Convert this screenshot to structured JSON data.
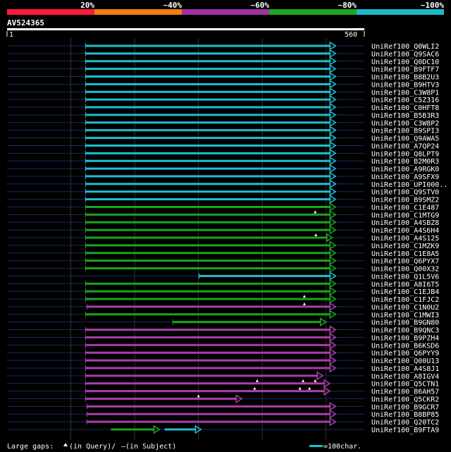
{
  "legend": {
    "bins": [
      {
        "label": "",
        "color": "#ff1a3c"
      },
      {
        "label": "20%",
        "color": "#f07e10"
      },
      {
        "label": "~40%",
        "color": "#a12fa0"
      },
      {
        "label": "~60%",
        "color": "#1fa51f"
      },
      {
        "label": "~80%",
        "color": "#1fb8c8"
      },
      {
        "label": "~100%",
        "color": null
      }
    ]
  },
  "query": {
    "name": "AV524365",
    "start": "1",
    "end": "560",
    "length": 560
  },
  "colors": {
    "cyan": "#1fbfcf",
    "green": "#1ca51c",
    "purple": "#a93ea8",
    "query_line": "#1a2a66",
    "gridline": "#333333"
  },
  "hits": [
    {
      "name": "UniRef100_Q0WLI2",
      "color": "cyan",
      "start": 123,
      "end": 515,
      "gaps": []
    },
    {
      "name": "UniRef100_Q9SAC6",
      "color": "cyan",
      "start": 123,
      "end": 515,
      "gaps": []
    },
    {
      "name": "UniRef100_Q0DC10",
      "color": "cyan",
      "start": 123,
      "end": 515,
      "gaps": []
    },
    {
      "name": "UniRef100_B9FTF7",
      "color": "cyan",
      "start": 123,
      "end": 515,
      "gaps": []
    },
    {
      "name": "UniRef100_B8B2U3",
      "color": "cyan",
      "start": 123,
      "end": 515,
      "gaps": []
    },
    {
      "name": "UniRef100_B9HTV3",
      "color": "cyan",
      "start": 123,
      "end": 515,
      "gaps": []
    },
    {
      "name": "UniRef100_C3W8P1",
      "color": "cyan",
      "start": 123,
      "end": 515,
      "gaps": []
    },
    {
      "name": "UniRef100_C5Z316",
      "color": "cyan",
      "start": 123,
      "end": 515,
      "gaps": []
    },
    {
      "name": "UniRef100_C0HFT8",
      "color": "cyan",
      "start": 123,
      "end": 515,
      "gaps": []
    },
    {
      "name": "UniRef100_B5B3R3",
      "color": "cyan",
      "start": 123,
      "end": 515,
      "gaps": []
    },
    {
      "name": "UniRef100_C3W8P2",
      "color": "cyan",
      "start": 123,
      "end": 515,
      "gaps": []
    },
    {
      "name": "UniRef100_B9SPI3",
      "color": "cyan",
      "start": 123,
      "end": 515,
      "gaps": []
    },
    {
      "name": "UniRef100_Q9AWA5",
      "color": "cyan",
      "start": 123,
      "end": 515,
      "gaps": []
    },
    {
      "name": "UniRef100_A7QP24",
      "color": "cyan",
      "start": 123,
      "end": 515,
      "gaps": []
    },
    {
      "name": "UniRef100_Q8LPT9",
      "color": "cyan",
      "start": 123,
      "end": 515,
      "gaps": []
    },
    {
      "name": "UniRef100_B2M0R3",
      "color": "cyan",
      "start": 123,
      "end": 515,
      "gaps": []
    },
    {
      "name": "UniRef100_A9RGK0",
      "color": "cyan",
      "start": 123,
      "end": 515,
      "gaps": []
    },
    {
      "name": "UniRef100_A9SFX9",
      "color": "cyan",
      "start": 123,
      "end": 515,
      "gaps": []
    },
    {
      "name": "UniRef100_UPI000..",
      "color": "cyan",
      "start": 123,
      "end": 515,
      "gaps": []
    },
    {
      "name": "UniRef100_Q9STV0",
      "color": "cyan",
      "start": 123,
      "end": 515,
      "gaps": []
    },
    {
      "name": "UniRef100_B9SMZ2",
      "color": "cyan",
      "start": 123,
      "end": 515,
      "gaps": []
    },
    {
      "name": "UniRef100_C1E487",
      "color": "green",
      "start": 123,
      "end": 515,
      "gaps": []
    },
    {
      "name": "UniRef100_C1MTG9",
      "color": "green",
      "start": 123,
      "end": 515,
      "gaps": [
        {
          "pos": 483,
          "type": "query"
        }
      ]
    },
    {
      "name": "UniRef100_A4SBZ8",
      "color": "green",
      "start": 123,
      "end": 515,
      "gaps": []
    },
    {
      "name": "UniRef100_A4S6H4",
      "color": "green",
      "start": 123,
      "end": 515,
      "gaps": []
    },
    {
      "name": "UniRef100_A4S125",
      "color": "green",
      "start": 123,
      "end": 510,
      "gaps": [
        {
          "pos": 484,
          "type": "query"
        }
      ]
    },
    {
      "name": "UniRef100_C1MZK9",
      "color": "green",
      "start": 123,
      "end": 515,
      "gaps": []
    },
    {
      "name": "UniRef100_C1E8A5",
      "color": "green",
      "start": 123,
      "end": 515,
      "gaps": []
    },
    {
      "name": "UniRef100_Q6PYX7",
      "color": "green",
      "start": 123,
      "end": 515,
      "gaps": []
    },
    {
      "name": "UniRef100_Q00X32",
      "color": "green",
      "start": 123,
      "end": 515,
      "gaps": []
    },
    {
      "name": "UniRef100_Q1L5V6",
      "color": "cyan",
      "start": 301,
      "end": 515,
      "gaps": []
    },
    {
      "name": "UniRef100_A8I6T5",
      "color": "green",
      "start": 123,
      "end": 515,
      "gaps": []
    },
    {
      "name": "UniRef100_C1EJB4",
      "color": "green",
      "start": 123,
      "end": 515,
      "gaps": []
    },
    {
      "name": "UniRef100_C1FJC2",
      "color": "green",
      "start": 123,
      "end": 515,
      "gaps": [
        {
          "pos": 466,
          "type": "query"
        }
      ]
    },
    {
      "name": "UniRef100_C1N0U2",
      "color": "purple",
      "start": 125,
      "end": 515,
      "gaps": [
        {
          "pos": 466,
          "type": "query"
        }
      ]
    },
    {
      "name": "UniRef100_C1MWI3",
      "color": "green",
      "start": 123,
      "end": 515,
      "gaps": []
    },
    {
      "name": "UniRef100_B9GN80",
      "color": "green",
      "start": 260,
      "end": 500,
      "gaps": []
    },
    {
      "name": "UniRef100_B9QNC3",
      "color": "purple",
      "start": 123,
      "end": 515,
      "gaps": []
    },
    {
      "name": "UniRef100_B9PZH4",
      "color": "purple",
      "start": 123,
      "end": 515,
      "gaps": []
    },
    {
      "name": "UniRef100_B6KSD6",
      "color": "purple",
      "start": 123,
      "end": 515,
      "gaps": []
    },
    {
      "name": "UniRef100_Q6PYY9",
      "color": "purple",
      "start": 123,
      "end": 515,
      "gaps": []
    },
    {
      "name": "UniRef100_Q00U13",
      "color": "purple",
      "start": 123,
      "end": 515,
      "gaps": []
    },
    {
      "name": "UniRef100_A4S8J1",
      "color": "purple",
      "start": 123,
      "end": 515,
      "gaps": []
    },
    {
      "name": "UniRef100_A8IGV4",
      "color": "purple",
      "start": 123,
      "end": 495,
      "gaps": []
    },
    {
      "name": "UniRef100_Q5CTN1",
      "color": "purple",
      "start": 123,
      "end": 506,
      "gaps": [
        {
          "pos": 392,
          "type": "query"
        },
        {
          "pos": 464,
          "type": "query"
        },
        {
          "pos": 483,
          "type": "query"
        }
      ]
    },
    {
      "name": "UniRef100_B6AH57",
      "color": "purple",
      "start": 123,
      "end": 506,
      "gaps": [
        {
          "pos": 388,
          "type": "query"
        },
        {
          "pos": 459,
          "type": "query"
        },
        {
          "pos": 474,
          "type": "query"
        }
      ]
    },
    {
      "name": "UniRef100_Q5CKR2",
      "color": "purple",
      "start": 123,
      "end": 368,
      "gaps": [
        {
          "pos": 300,
          "type": "query"
        }
      ]
    },
    {
      "name": "UniRef100_B9GCR7",
      "color": "purple",
      "start": 125,
      "end": 515,
      "gaps": []
    },
    {
      "name": "UniRef100_B8BP85",
      "color": "purple",
      "start": 125,
      "end": 515,
      "gaps": []
    },
    {
      "name": "UniRef100_Q20TC2",
      "color": "purple",
      "start": 125,
      "end": 515,
      "gaps": []
    },
    {
      "name": "UniRef100_B9FTA9",
      "color": "multi",
      "segments": [
        {
          "start": 163,
          "end": 239,
          "color": "green"
        },
        {
          "start": 247,
          "end": 304,
          "color": "cyan"
        }
      ],
      "gaps": []
    }
  ],
  "footer": {
    "large_gaps_prefix": "Large gaps:",
    "query_gap_text": "(in Query)/",
    "subject_gap_symbol": "–",
    "subject_gap_text": " (in Subject)",
    "scale_text": "=100char."
  }
}
